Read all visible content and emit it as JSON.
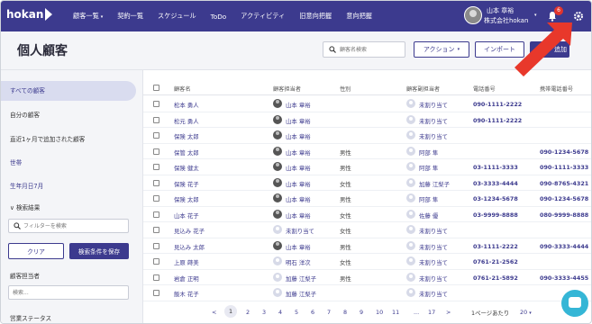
{
  "app": {
    "logo_text": "hokan",
    "nav": [
      {
        "label": "顧客一覧",
        "caret": "▾"
      },
      {
        "label": "契約一覧"
      },
      {
        "label": "スケジュール"
      },
      {
        "label": "ToDo"
      },
      {
        "label": "アクティビティ"
      },
      {
        "label": "旧意向把握"
      },
      {
        "label": "意向把握"
      }
    ],
    "user": {
      "name": "山本 章裕",
      "company": "株式会社hokan"
    },
    "notification_count": "6"
  },
  "header": {
    "title": "個人顧客",
    "search_placeholder": "顧客名検索",
    "action_label": "アクション",
    "action_caret": "▾",
    "import_label": "インポート",
    "add_label": "追加"
  },
  "sidebar": {
    "items": [
      {
        "label": "すべての顧客"
      },
      {
        "label": "自分の顧客"
      },
      {
        "label": "直近1ヶ月で追加された顧客"
      },
      {
        "label": "世帯"
      },
      {
        "label": "生年月日7月"
      }
    ],
    "filter_heading": "検索結果",
    "filter_caret": "∨",
    "filter_placeholder": "フィルターを検索",
    "clear_label": "クリア",
    "save_label": "検索条件を保存",
    "owner_label": "顧客担当者",
    "owner_placeholder": "検索...",
    "status_label": "営業ステータス"
  },
  "table": {
    "columns": [
      "顧客名",
      "顧客担当者",
      "性別",
      "顧客副担当者",
      "電話番号",
      "携帯電話番号"
    ],
    "rows": [
      {
        "name": "松本 勇人",
        "owner": "山本 章裕",
        "owner_avatar": "photo",
        "gender": "",
        "sub": "未割り当て",
        "tel": "090-1111-2222",
        "mobile": ""
      },
      {
        "name": "松元 勇人",
        "owner": "山本 章裕",
        "owner_avatar": "photo",
        "gender": "",
        "sub": "未割り当て",
        "tel": "090-1111-2222",
        "mobile": ""
      },
      {
        "name": "保険 太郎",
        "owner": "山本 章裕",
        "owner_avatar": "photo",
        "gender": "",
        "sub": "未割り当て",
        "tel": "",
        "mobile": ""
      },
      {
        "name": "保管 太郎",
        "owner": "山本 章裕",
        "owner_avatar": "photo",
        "gender": "男性",
        "sub": "阿部 隼",
        "tel": "",
        "mobile": "090-1234-5678"
      },
      {
        "name": "保険 健太",
        "owner": "山本 章裕",
        "owner_avatar": "photo",
        "gender": "男性",
        "sub": "阿部 隼",
        "tel": "03-1111-3333",
        "mobile": "090-1111-3333"
      },
      {
        "name": "保険 花子",
        "owner": "山本 章裕",
        "owner_avatar": "photo",
        "gender": "女性",
        "sub": "加藤 江梨子",
        "tel": "03-3333-4444",
        "mobile": "090-8765-4321"
      },
      {
        "name": "保険 太郎",
        "owner": "山本 章裕",
        "owner_avatar": "photo",
        "gender": "男性",
        "sub": "阿部 隼",
        "tel": "03-1234-5678",
        "mobile": "090-1234-5678"
      },
      {
        "name": "山本 花子",
        "owner": "山本 章裕",
        "owner_avatar": "photo",
        "gender": "女性",
        "sub": "佐藤 優",
        "tel": "03-9999-8888",
        "mobile": "080-9999-8888"
      },
      {
        "name": "見込み 花子",
        "owner": "未割り当て",
        "owner_avatar": "blank",
        "gender": "女性",
        "sub": "未割り当て",
        "tel": "",
        "mobile": ""
      },
      {
        "name": "見込み 太郎",
        "owner": "山本 章裕",
        "owner_avatar": "photo",
        "gender": "男性",
        "sub": "未割り当て",
        "tel": "03-1111-2222",
        "mobile": "090-3333-4444"
      },
      {
        "name": "上原 蒔美",
        "owner": "明石 洋次",
        "owner_avatar": "blank",
        "gender": "女性",
        "sub": "未割り当て",
        "tel": "0761-21-2562",
        "mobile": ""
      },
      {
        "name": "岩倉 正明",
        "owner": "加藤 江梨子",
        "owner_avatar": "blank",
        "gender": "男性",
        "sub": "未割り当て",
        "tel": "0761-21-5892",
        "mobile": "090-3333-4455"
      },
      {
        "name": "飯木 花子",
        "owner": "加藤 江梨子",
        "owner_avatar": "blank",
        "gender": "",
        "sub": "未割り当て",
        "tel": "",
        "mobile": ""
      }
    ]
  },
  "pagination": {
    "prev": "<",
    "current": "1",
    "pages": [
      "2",
      "3",
      "4",
      "5",
      "6",
      "7",
      "8",
      "9",
      "10",
      "11"
    ],
    "ellipsis": "...",
    "last": "17",
    "next": ">",
    "per_page_label": "1ページあたり",
    "per_page_value": "20",
    "per_page_caret": "▾"
  }
}
